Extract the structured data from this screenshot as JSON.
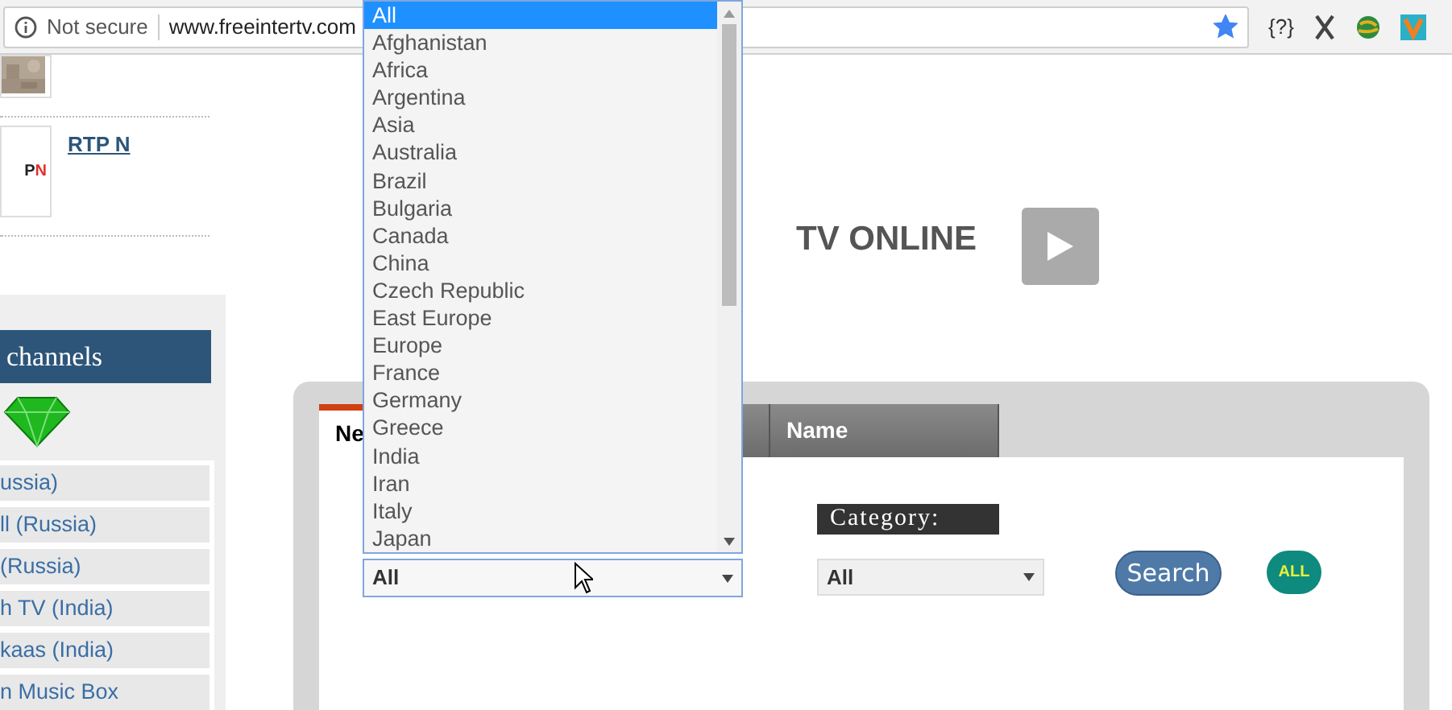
{
  "browser": {
    "security": "Not secure",
    "url": "www.freeintertv.com",
    "bookmarked": true,
    "extension_label": "{?}"
  },
  "left_column": {
    "rtp": {
      "logo_text": "P",
      "logo_accent": "N",
      "link": "RTP N"
    },
    "channels_header": "channels",
    "channels": [
      "ussia)",
      "ll (Russia)",
      "(Russia)",
      "h TV (India)",
      "kaas (India)",
      "n Music Box"
    ]
  },
  "hero": {
    "title": "TV ONLINE"
  },
  "panel": {
    "tabs": [
      {
        "label": "Ne",
        "selected": true
      },
      {
        "selected": false
      },
      {
        "label": "Name",
        "selected": false
      }
    ],
    "country_select": {
      "value": "All",
      "open": true
    },
    "category_label": "Category:",
    "category_select": {
      "value": "All"
    },
    "search_button": "Search",
    "all_button": "ALL"
  },
  "dropdown": {
    "options": [
      {
        "label": "All",
        "selected": true
      },
      {
        "label": "Afghanistan",
        "selected": false
      },
      {
        "label": "Africa",
        "selected": false
      },
      {
        "label": "Argentina",
        "selected": false
      },
      {
        "label": "Asia",
        "selected": false
      },
      {
        "label": "Australia",
        "selected": false
      },
      {
        "label": "Brazil",
        "selected": false
      },
      {
        "label": "Bulgaria",
        "selected": false
      },
      {
        "label": "Canada",
        "selected": false
      },
      {
        "label": "China",
        "selected": false
      },
      {
        "label": "Czech Republic",
        "selected": false
      },
      {
        "label": "East Europe",
        "selected": false
      },
      {
        "label": "Europe",
        "selected": false
      },
      {
        "label": "France",
        "selected": false
      },
      {
        "label": "Germany",
        "selected": false
      },
      {
        "label": "Greece",
        "selected": false
      },
      {
        "label": "India",
        "selected": false
      },
      {
        "label": "Iran",
        "selected": false
      },
      {
        "label": "Italy",
        "selected": false
      },
      {
        "label": "Japan",
        "selected": false
      }
    ]
  }
}
